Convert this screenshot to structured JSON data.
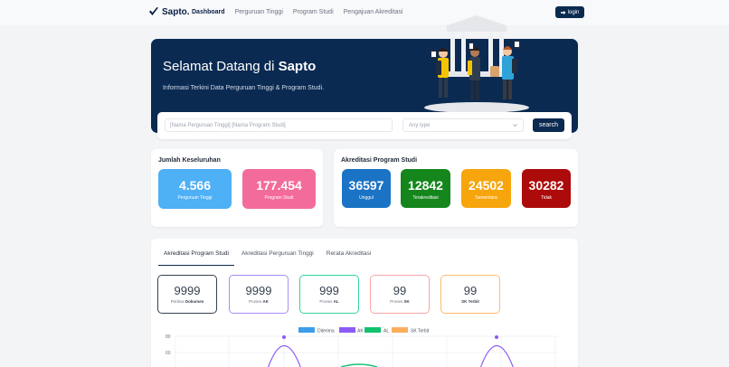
{
  "nav": {
    "brand": "Sapto.",
    "links": [
      "Dashboard",
      "Perguruan Tinggi",
      "Program Studi",
      "Pengajuan Akreditasi"
    ],
    "login": "login"
  },
  "hero": {
    "title_prefix": "Selamat Datang di",
    "title_brand": "Sapto",
    "subtitle": "Informasi Terkini Data Perguruan Tinggi & Program Studi."
  },
  "search": {
    "placeholder": "[Nama Perguruan Tinggi] [Nama Program Studi]",
    "type_placeholder": "Any type",
    "button": "search"
  },
  "totals": {
    "title": "Jumlah Keseluruhan",
    "items": [
      {
        "value": "4.566",
        "label": "Perguruan Tinggi",
        "color": "#4eb0f5"
      },
      {
        "value": "177.454",
        "label": "Program Studi",
        "color": "#f36b9a"
      }
    ]
  },
  "akreditasi": {
    "title": "Akreditasi Program Studi",
    "items": [
      {
        "value": "36597",
        "label": "Unggul",
        "color": "#1a73c4"
      },
      {
        "value": "12842",
        "label": "Terakreditasi",
        "color": "#14861c"
      },
      {
        "value": "24502",
        "label": "Sementara",
        "color": "#f7a50c"
      },
      {
        "value": "30282",
        "label": "Tidak",
        "color": "#ad0b0b"
      }
    ]
  },
  "panel": {
    "tabs": [
      "Akreditasi Program Studi",
      "Akreditasi Perguruan Tinggi",
      "Rerata Akreditasi"
    ],
    "mini": [
      {
        "value": "9999",
        "label_a": "Periksa",
        "label_b": "Dokumen",
        "border": "#374151"
      },
      {
        "value": "9999",
        "label_a": "Proses",
        "label_b": "AK",
        "border": "#a78bfa"
      },
      {
        "value": "999",
        "label_a": "Proses",
        "label_b": "AL",
        "border": "#34d399"
      },
      {
        "value": "99",
        "label_a": "Proses",
        "label_b": "SK",
        "border": "#fca5a5"
      },
      {
        "value": "99",
        "label_a": "",
        "label_b": "SK Terbit",
        "border": "#fdba74"
      }
    ]
  },
  "chart_data": {
    "type": "line",
    "series": [
      {
        "name": "Diterima",
        "color": "#3b9eea"
      },
      {
        "name": "AK",
        "color": "#8b5cf6"
      },
      {
        "name": "AL",
        "color": "#10c26e"
      },
      {
        "name": "SK Terbit",
        "color": "#fbae5c"
      }
    ],
    "y_ticks": [
      "80",
      "60"
    ],
    "grid": true,
    "legend": "top"
  }
}
